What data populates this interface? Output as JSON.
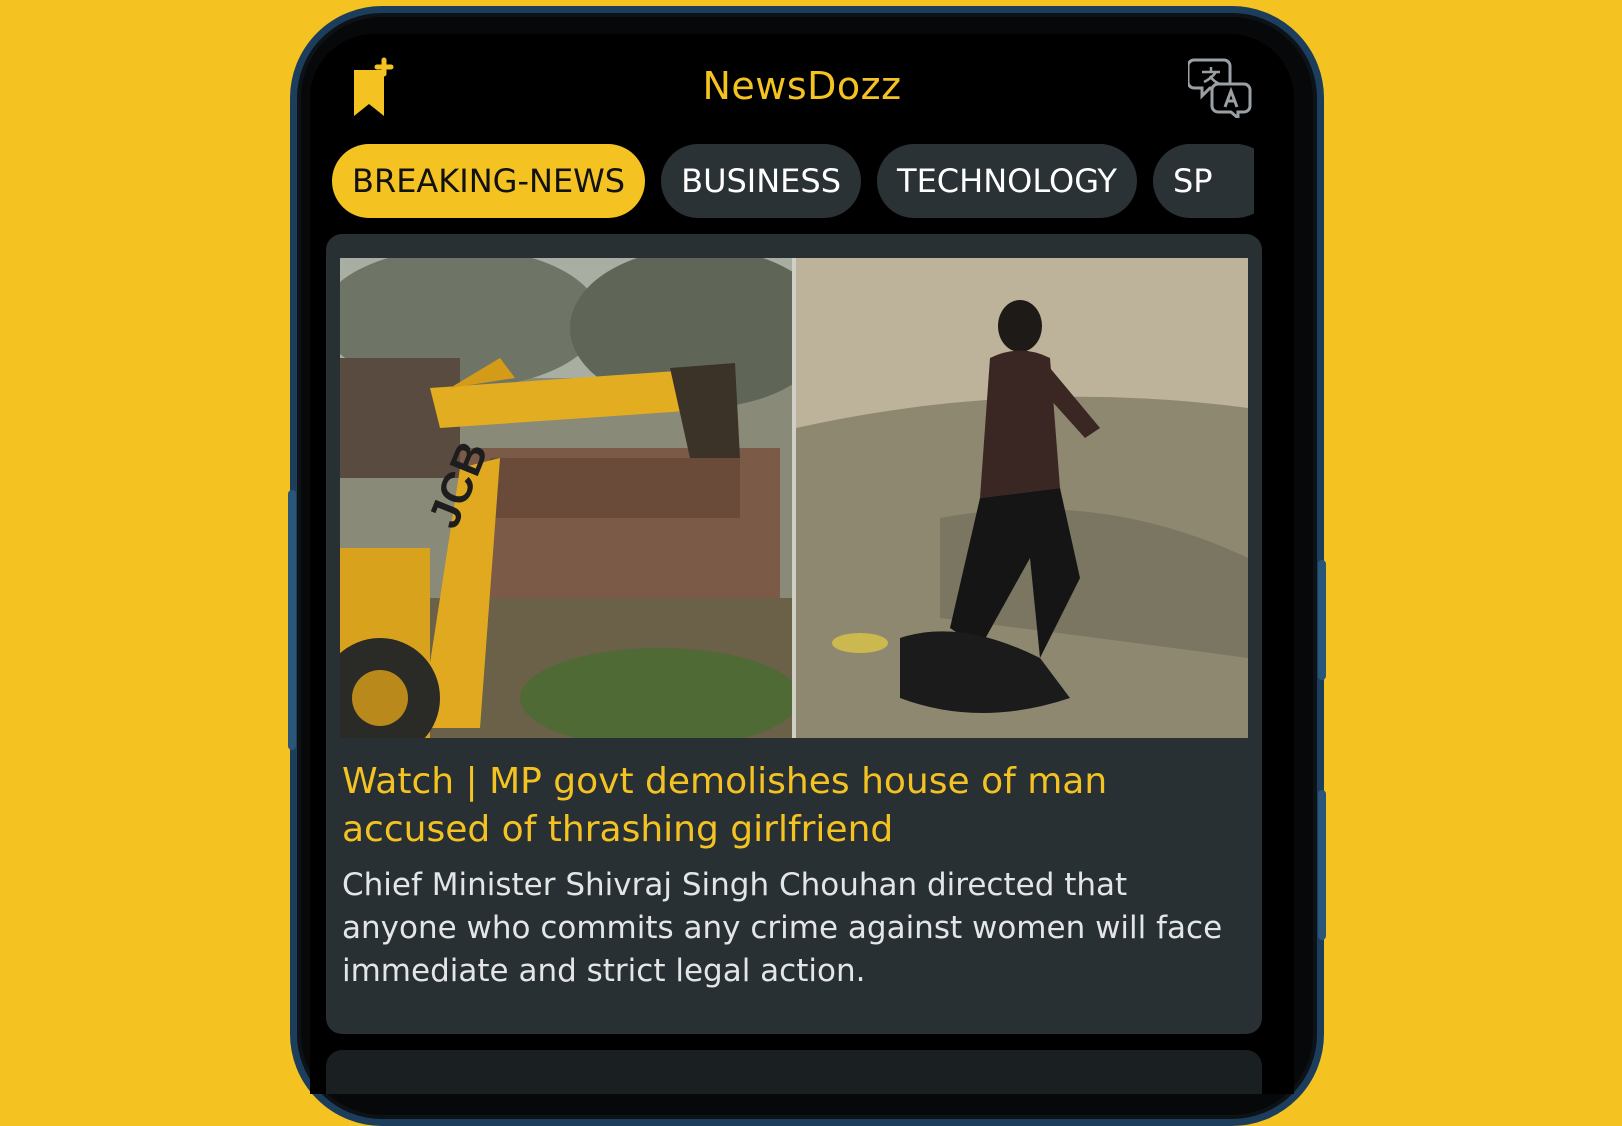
{
  "app": {
    "title": "NewsDozz",
    "accent_color": "#F4C322",
    "background_color": "#F4C322"
  },
  "header": {
    "left_icon": "bookmark-add-icon",
    "right_icon": "translate-icon"
  },
  "tabs": [
    {
      "label": "BREAKING-NEWS",
      "active": true
    },
    {
      "label": "BUSINESS",
      "active": false
    },
    {
      "label": "TECHNOLOGY",
      "active": false
    },
    {
      "label": "SP",
      "active": false
    }
  ],
  "article": {
    "headline": "Watch | MP govt demolishes house of man accused of thrashing girlfriend",
    "summary": "Chief Minister Shivraj Singh Chouhan directed that anyone who commits any crime against women will face immediate and strict legal action.",
    "image_text": "JCB"
  }
}
